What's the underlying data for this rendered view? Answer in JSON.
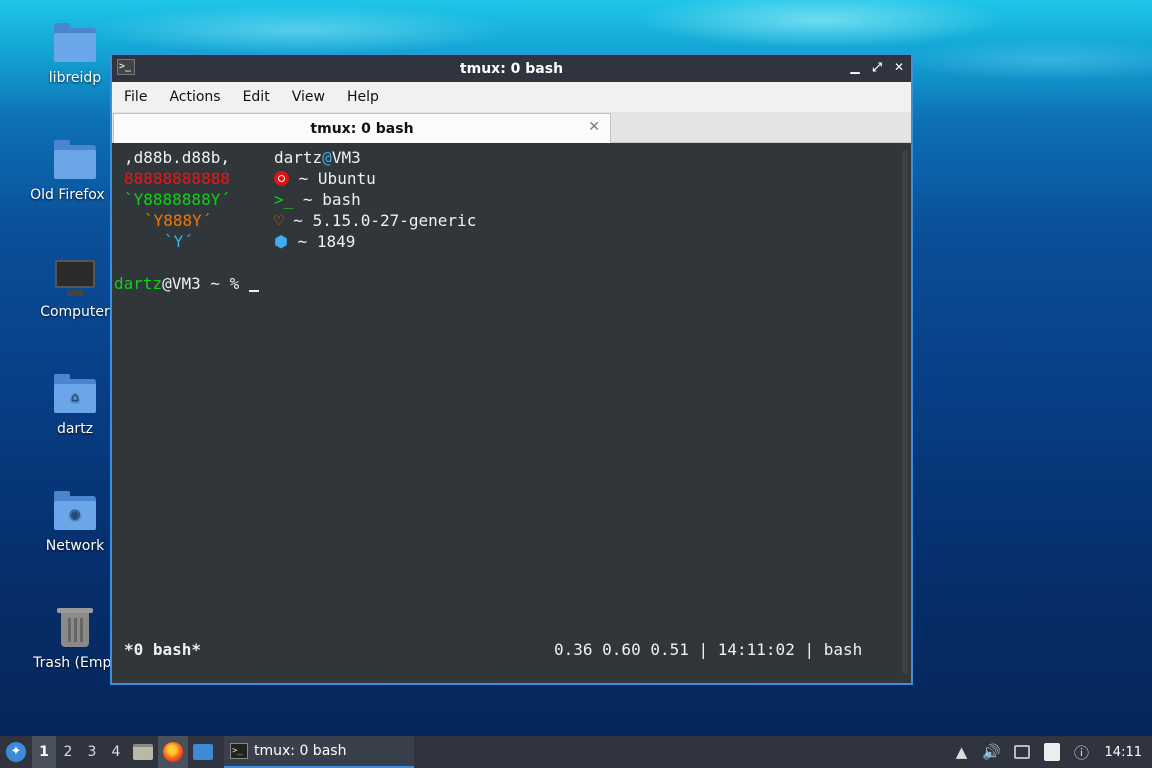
{
  "desktop": {
    "icons": [
      {
        "label": "libreidp",
        "icon": "folder-icon"
      },
      {
        "label": "Old Firefox D",
        "icon": "folder-icon"
      },
      {
        "label": "Computer",
        "icon": "computer-icon"
      },
      {
        "label": "dartz",
        "icon": "home-folder-icon"
      },
      {
        "label": "Network",
        "icon": "network-folder-icon"
      },
      {
        "label": "Trash (Empt",
        "icon": "trash-icon"
      }
    ]
  },
  "window": {
    "title": "tmux: 0 bash",
    "controls": {
      "minimize": "▁",
      "maximize": "⤢",
      "close": "✕"
    },
    "menu": [
      "File",
      "Actions",
      "Edit",
      "View",
      "Help"
    ],
    "tab": {
      "label": "tmux: 0 bash",
      "close": "✕"
    },
    "terminal": {
      "art": [
        ",d88b.d88b,",
        "88888888888",
        "`Y8888888Y´",
        "`Y888Y´",
        "`Y´"
      ],
      "user": "dartz",
      "at": "@",
      "host": "VM3",
      "info": [
        {
          "icon": "ubuntu-icon",
          "sep": "~",
          "value": "Ubuntu"
        },
        {
          "icon": ">_",
          "sep": "~",
          "value": "bash"
        },
        {
          "icon": "♡",
          "sep": "~",
          "value": "5.15.0-27-generic"
        },
        {
          "icon": "⬢",
          "sep": "~",
          "value": "1849"
        }
      ],
      "prompt": {
        "user": "dartz",
        "host": "@VM3",
        "path": " ~ % "
      },
      "status_left": "*0 bash*",
      "status_right": "0.36 0.60 0.51 | 14:11:02 | bash"
    }
  },
  "taskbar": {
    "start_icon": "start-menu-icon",
    "workspaces": [
      "1",
      "2",
      "3",
      "4"
    ],
    "task_label": "tmux: 0 bash",
    "clock": "14:11",
    "colors": {
      "accent": "#3b8fe0",
      "panel": "#2f343f"
    }
  }
}
